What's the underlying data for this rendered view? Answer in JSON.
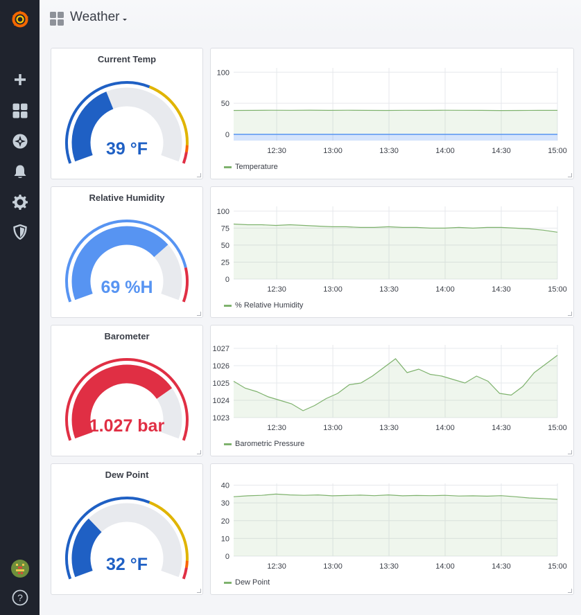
{
  "dashboard": {
    "title": "Weather"
  },
  "sidebar": {
    "items": [
      {
        "icon": "grafana-logo-icon"
      },
      {
        "icon": "plus-icon"
      },
      {
        "icon": "dashboards-icon"
      },
      {
        "icon": "compass-icon"
      },
      {
        "icon": "bell-icon"
      },
      {
        "icon": "gear-icon"
      },
      {
        "icon": "shield-icon"
      },
      {
        "icon": "avatar"
      },
      {
        "icon": "help-icon",
        "label": "?"
      }
    ]
  },
  "rows": [
    {
      "gauge": {
        "title": "Current Temp",
        "value_text": "39 °F",
        "fraction": 0.4,
        "value_color": "#1f60c4",
        "bands": [
          [
            "#1f60c4",
            0.0,
            0.6
          ],
          [
            "#e0b400",
            0.6,
            0.92
          ],
          [
            "#fa6400",
            0.92,
            0.95
          ],
          [
            "#e02f44",
            0.95,
            1.0
          ]
        ]
      },
      "chart": {
        "legend": "Temperature",
        "y_ticks": [
          "100",
          "50",
          "0"
        ],
        "x_ticks": [
          "12:30",
          "13:00",
          "13:30",
          "14:00",
          "14:30",
          "15:00"
        ]
      }
    },
    {
      "gauge": {
        "title": "Relative Humidity",
        "value_text": "69 %H",
        "fraction": 0.72,
        "value_color": "#5794f2",
        "bands": [
          [
            "#5794f2",
            0.0,
            0.85
          ],
          [
            "#e02f44",
            0.85,
            1.0
          ]
        ]
      },
      "chart": {
        "legend": "% Relative Humidity",
        "y_ticks": [
          "100",
          "75",
          "50",
          "25",
          "0"
        ],
        "x_ticks": [
          "12:30",
          "13:00",
          "13:30",
          "14:00",
          "14:30",
          "15:00"
        ]
      }
    },
    {
      "gauge": {
        "title": "Barometer",
        "value_text": "1.027 bar",
        "fraction": 0.75,
        "value_color": "#e02f44",
        "bands": [
          [
            "#e02f44",
            0.0,
            1.0
          ]
        ]
      },
      "chart": {
        "legend": "Barometric Pressure",
        "y_ticks": [
          "1027",
          "1026",
          "1025",
          "1024",
          "1023"
        ],
        "x_ticks": [
          "12:30",
          "13:00",
          "13:30",
          "14:00",
          "14:30",
          "15:00"
        ]
      }
    },
    {
      "gauge": {
        "title": "Dew Point",
        "value_text": "32 °F",
        "fraction": 0.3,
        "value_color": "#1f60c4",
        "bands": [
          [
            "#1f60c4",
            0.0,
            0.6
          ],
          [
            "#e0b400",
            0.6,
            0.92
          ],
          [
            "#fa6400",
            0.92,
            0.95
          ],
          [
            "#e02f44",
            0.95,
            1.0
          ]
        ]
      },
      "chart": {
        "legend": "Dew Point",
        "y_ticks": [
          "40",
          "30",
          "20",
          "10",
          "0"
        ],
        "x_ticks": [
          "12:30",
          "13:00",
          "13:30",
          "14:00",
          "14:30",
          "15:00"
        ]
      }
    }
  ],
  "chart_data": [
    {
      "type": "line",
      "series": [
        {
          "name": "Temperature",
          "values": [
            38.5,
            38.6,
            38.8,
            38.7,
            38.9,
            38.6,
            38.8,
            38.6,
            38.5,
            38.7,
            38.6,
            38.8,
            38.7,
            38.6,
            38.4,
            38.5,
            38.6,
            38.6
          ]
        }
      ],
      "x_start": "12:07",
      "x_end": "15:00",
      "ylim": [
        -10,
        107
      ],
      "color": "#7eb26d"
    },
    {
      "type": "line",
      "series": [
        {
          "name": "% Relative Humidity",
          "values": [
            81,
            80,
            80,
            79,
            80,
            79,
            78,
            77,
            77,
            76,
            76,
            77,
            76,
            76,
            75,
            75,
            76,
            75,
            76,
            76,
            75,
            74,
            72,
            69
          ]
        }
      ],
      "x_start": "12:07",
      "x_end": "15:00",
      "ylim": [
        0,
        107
      ],
      "color": "#7eb26d"
    },
    {
      "type": "line",
      "series": [
        {
          "name": "Barometric Pressure",
          "values": [
            1025.1,
            1024.7,
            1024.5,
            1024.2,
            1024.0,
            1023.8,
            1023.4,
            1023.7,
            1024.1,
            1024.4,
            1024.9,
            1025.0,
            1025.4,
            1025.9,
            1026.4,
            1025.6,
            1025.8,
            1025.5,
            1025.4,
            1025.2,
            1025.0,
            1025.4,
            1025.1,
            1024.4,
            1024.3,
            1024.8,
            1025.6,
            1026.1,
            1026.6
          ]
        }
      ],
      "x_start": "12:07",
      "x_end": "15:00",
      "ylim": [
        1023,
        1027.2
      ],
      "color": "#7eb26d"
    },
    {
      "type": "line",
      "series": [
        {
          "name": "Dew Point",
          "values": [
            33.5,
            34,
            34.3,
            35,
            34.5,
            34.3,
            34.5,
            34,
            34.2,
            34.4,
            34.1,
            34.5,
            34,
            34.2,
            34.1,
            34.3,
            33.9,
            34,
            33.8,
            34.1,
            33.5,
            32.8,
            32.5,
            32
          ]
        }
      ],
      "x_start": "12:07",
      "x_end": "15:00",
      "ylim": [
        0,
        41
      ],
      "color": "#7eb26d"
    }
  ]
}
